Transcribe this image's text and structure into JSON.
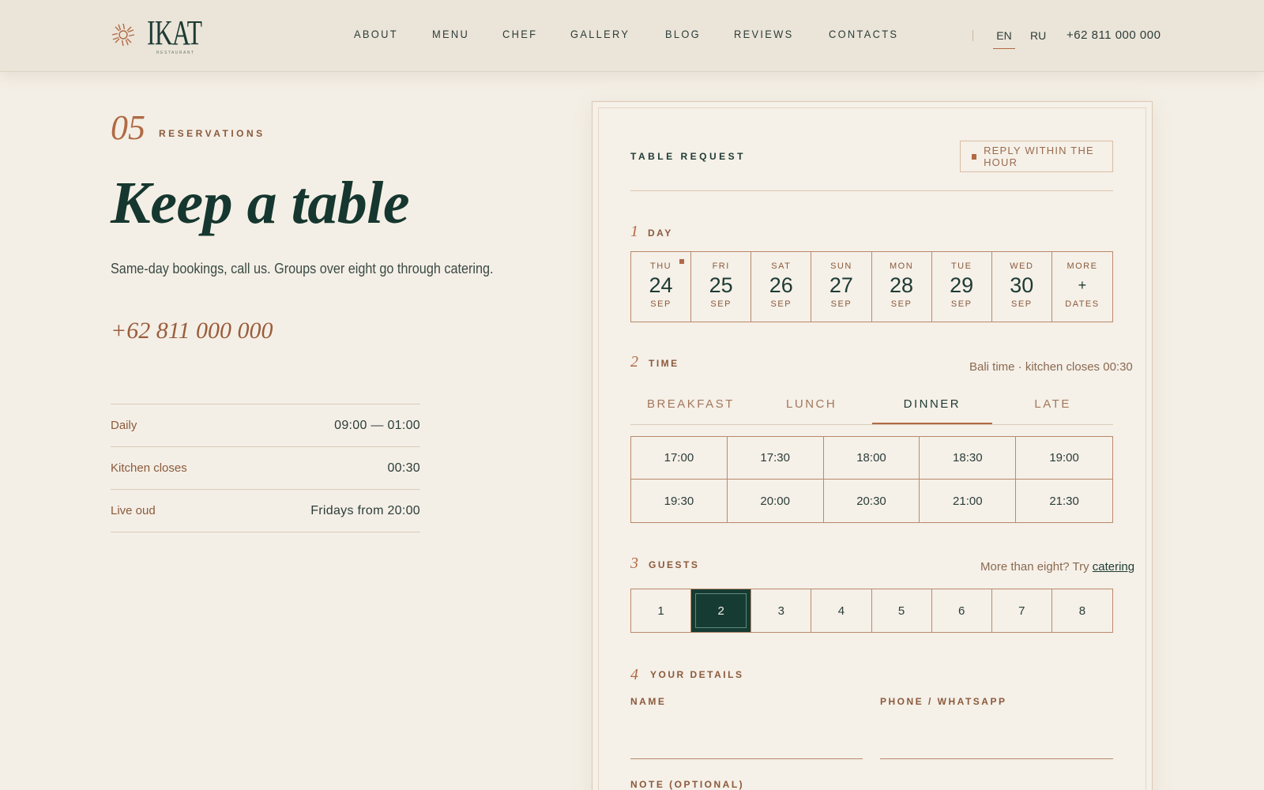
{
  "brand": {
    "name": "IKAT",
    "tagline": "RESTAURANT",
    "accent_color": "#b06a44",
    "primary_color": "#163b33",
    "background_color": "#f4efe6"
  },
  "header": {
    "nav": [
      "ABOUT",
      "MENU",
      "CHEF",
      "GALLERY",
      "BLOG",
      "REVIEWS",
      "CONTACTS"
    ],
    "lang_en": "EN",
    "lang_ru": "RU",
    "active_lang": "EN",
    "phone": "+62 811 000 000"
  },
  "intro": {
    "section_number": "05",
    "section_label": "RESERVATIONS",
    "headline": "Keep a table",
    "subline": "Same-day bookings, call us. Groups over eight go through catering.",
    "phone": "+62 811 000 000",
    "hours": [
      {
        "label": "Daily",
        "value": "09:00 — 01:00"
      },
      {
        "label": "Kitchen closes",
        "value": "00:30"
      },
      {
        "label": "Live oud",
        "value": "Fridays from 20:00"
      }
    ]
  },
  "form": {
    "title": "TABLE REQUEST",
    "reply_badge": "REPLY WITHIN THE HOUR",
    "step1": {
      "num": "1",
      "label": "DAY"
    },
    "days": [
      {
        "dow": "THU",
        "day": "24",
        "month": "SEP",
        "today": true
      },
      {
        "dow": "FRI",
        "day": "25",
        "month": "SEP"
      },
      {
        "dow": "SAT",
        "day": "26",
        "month": "SEP"
      },
      {
        "dow": "SUN",
        "day": "27",
        "month": "SEP"
      },
      {
        "dow": "MON",
        "day": "28",
        "month": "SEP"
      },
      {
        "dow": "TUE",
        "day": "29",
        "month": "SEP"
      },
      {
        "dow": "WED",
        "day": "30",
        "month": "SEP"
      },
      {
        "dow": "MORE",
        "day": "+",
        "month": "DATES"
      }
    ],
    "step2": {
      "num": "2",
      "label": "TIME",
      "aside": "Bali time · kitchen closes 00:30"
    },
    "meal_tabs": [
      "BREAKFAST",
      "LUNCH",
      "DINNER",
      "LATE"
    ],
    "active_tab": "DINNER",
    "times": [
      "17:00",
      "17:30",
      "18:00",
      "18:30",
      "19:00",
      "19:30",
      "20:00",
      "20:30",
      "21:00",
      "21:30"
    ],
    "step3": {
      "num": "3",
      "label": "GUESTS",
      "aside": "More than eight? Try",
      "aside_link": "catering"
    },
    "guests": [
      "1",
      "2",
      "3",
      "4",
      "5",
      "6",
      "7",
      "8"
    ],
    "selected_guests": "2",
    "step4": {
      "num": "4",
      "label": "YOUR DETAILS"
    },
    "name_label": "NAME",
    "name_value": "",
    "phone_label": "PHONE / WHATSAPP",
    "phone_value": "",
    "note_label": "NOTE (OPTIONAL)"
  }
}
